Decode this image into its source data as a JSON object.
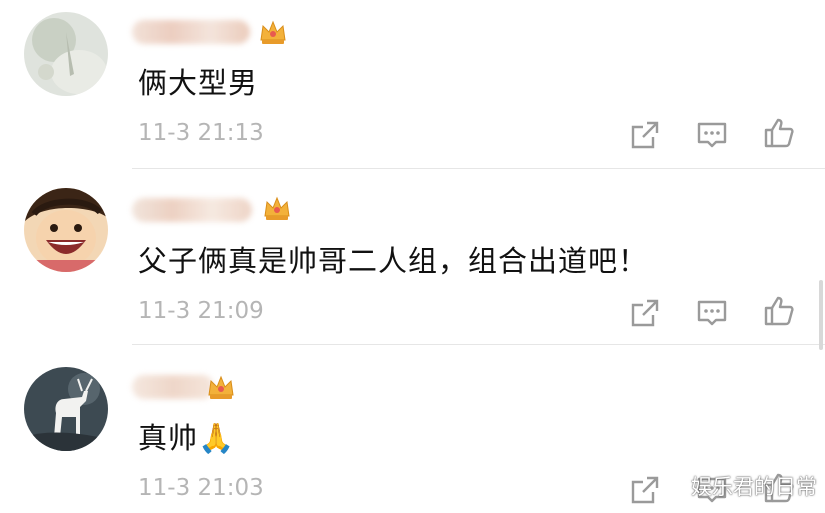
{
  "comments": [
    {
      "text": "俩大型男",
      "time": "11-3 21:13"
    },
    {
      "text": "父子俩真是帅哥二人组，组合出道吧！",
      "time": "11-3 21:09"
    },
    {
      "text": "真帅🙏",
      "time": "11-3 21:03"
    }
  ],
  "actions": {
    "share_icon": "share-icon",
    "reply_icon": "comment-icon",
    "like_icon": "thumbs-up-icon"
  },
  "watermark": "娱乐君的日常",
  "colors": {
    "text": "#111111",
    "meta": "#b5b5b5",
    "icon": "#9a9a9a",
    "crown": "#f3b13a"
  }
}
